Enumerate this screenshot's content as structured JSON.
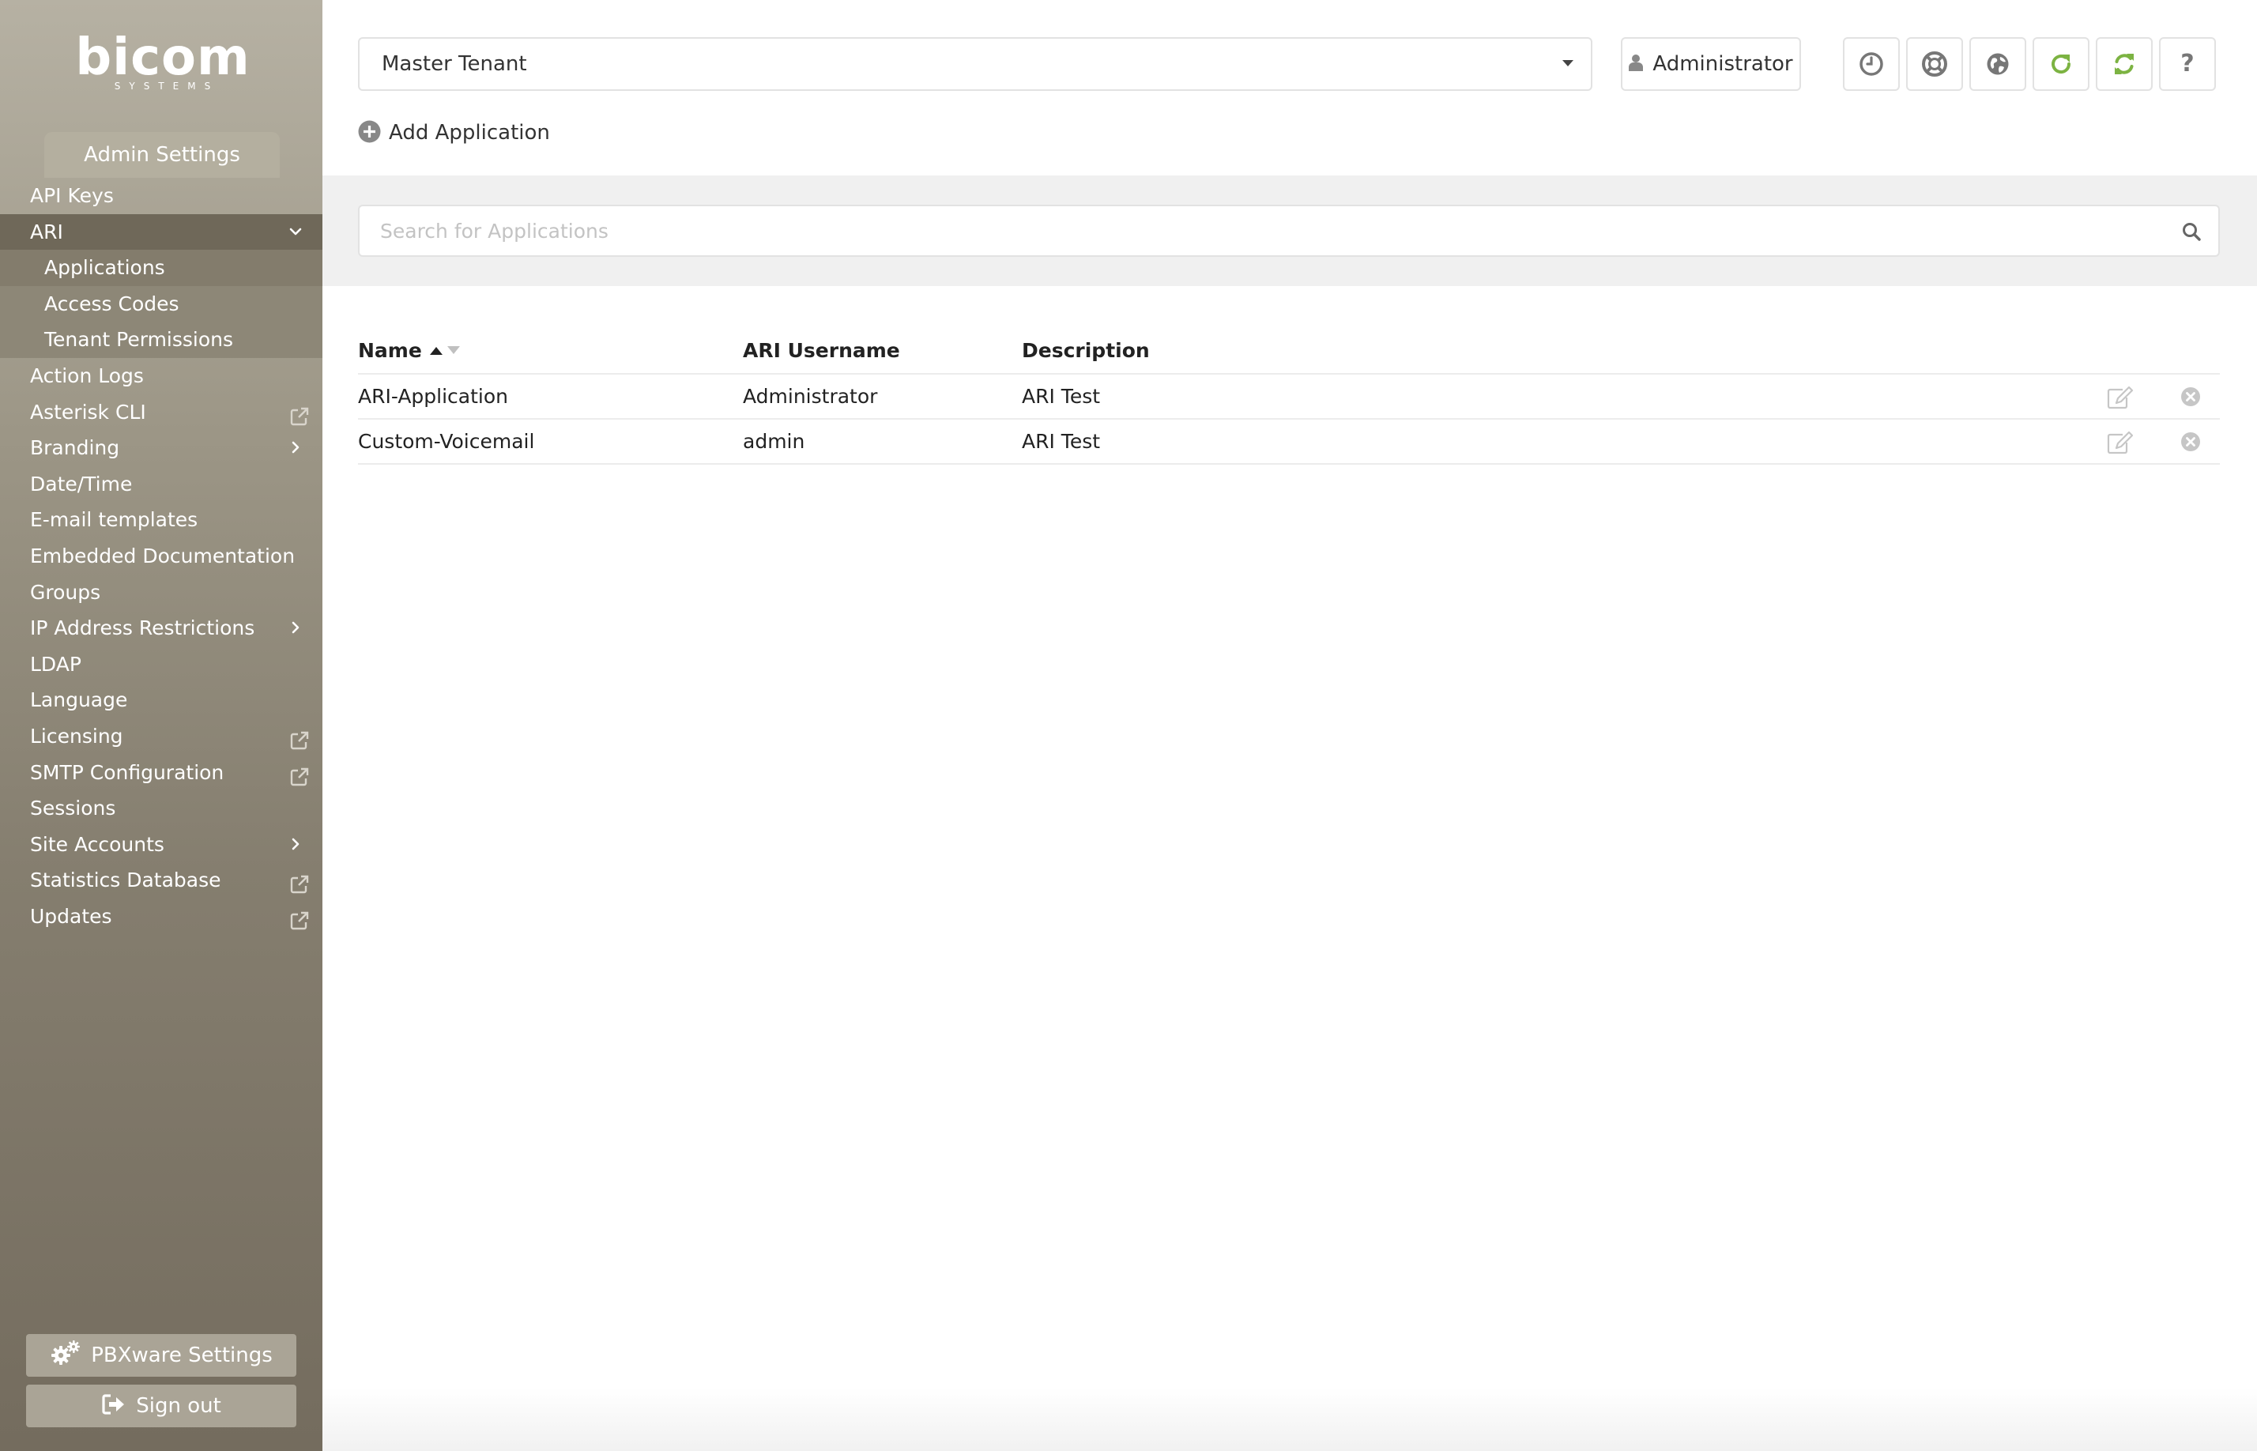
{
  "brand": {
    "logo_text": "bicom",
    "logo_subtext": "SYSTEMS"
  },
  "sidebar": {
    "section_tab": "Admin Settings",
    "items": [
      {
        "label": "API Keys"
      },
      {
        "label": "ARI",
        "expanded": true
      },
      {
        "label": "Applications",
        "sub": true,
        "active": true
      },
      {
        "label": "Access Codes",
        "sub": true
      },
      {
        "label": "Tenant Permissions",
        "sub": true
      },
      {
        "label": "Action Logs"
      },
      {
        "label": "Asterisk CLI",
        "external": true
      },
      {
        "label": "Branding",
        "has_submenu": true
      },
      {
        "label": "Date/Time"
      },
      {
        "label": "E-mail templates"
      },
      {
        "label": "Embedded Documentation"
      },
      {
        "label": "Groups"
      },
      {
        "label": "IP Address Restrictions",
        "has_submenu": true
      },
      {
        "label": "LDAP"
      },
      {
        "label": "Language"
      },
      {
        "label": "Licensing",
        "external": true
      },
      {
        "label": "SMTP Configuration",
        "external": true
      },
      {
        "label": "Sessions"
      },
      {
        "label": "Site Accounts",
        "has_submenu": true
      },
      {
        "label": "Statistics Database",
        "external": true
      },
      {
        "label": "Updates",
        "external": true
      }
    ],
    "pbxware_settings_label": "PBXware Settings",
    "sign_out_label": "Sign out"
  },
  "header": {
    "tenant_selected": "Master Tenant",
    "user_label": "Administrator",
    "toolbar_icons": [
      "clock-icon",
      "lifebuoy-icon",
      "globe-icon",
      "reload-icon",
      "sync-icon",
      "help-icon"
    ],
    "help_glyph": "?"
  },
  "actions": {
    "add_application_label": "Add Application"
  },
  "search": {
    "placeholder": "Search for Applications",
    "value": ""
  },
  "table": {
    "columns": [
      "Name",
      "ARI Username",
      "Description"
    ],
    "sort": {
      "column": "Name",
      "direction": "ascending"
    },
    "rows": [
      {
        "name": "ARI-Application",
        "ari_username": "Administrator",
        "description": "ARI Test"
      },
      {
        "name": "Custom-Voicemail",
        "ari_username": "admin",
        "description": "ARI Test"
      }
    ]
  },
  "colors": {
    "sidebar_top": "#b6b1a3",
    "sidebar_bottom": "#746c5e",
    "accent_green": "#7cb342",
    "icon_gray": "#777777",
    "border": "#e2e2e2"
  }
}
